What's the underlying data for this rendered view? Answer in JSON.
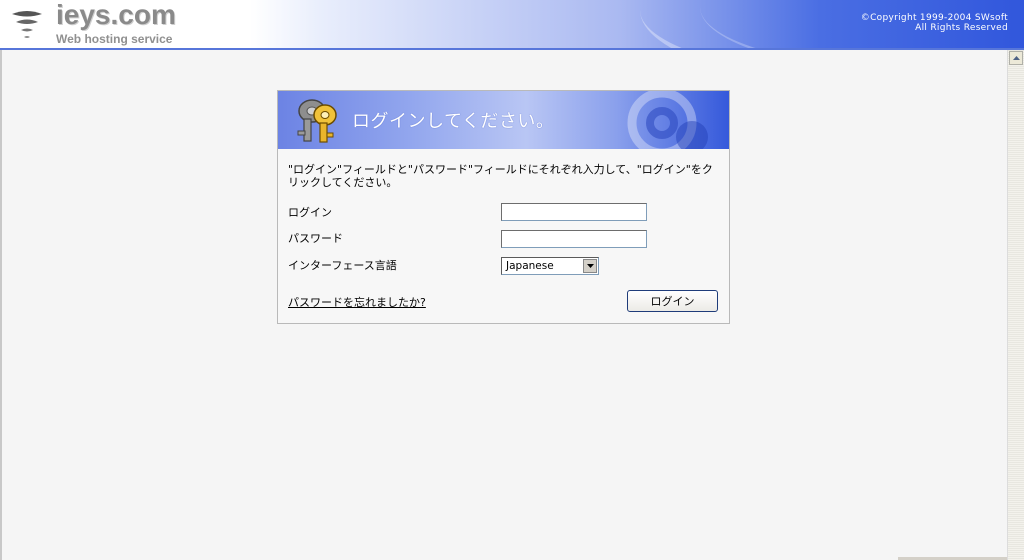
{
  "header": {
    "logo_text": "ieys.com",
    "logo_subtitle": "Web hosting service",
    "copyright_line1": "©Copyright 1999-2004 SWsoft",
    "copyright_line2": "All Rights Reserved",
    "logo_icon": "tornado-icon"
  },
  "login_panel": {
    "title": "ログインしてください。",
    "title_icon": "keys-icon",
    "instructions": "\"ログイン\"フィールドと\"パスワード\"フィールドにそれぞれ入力して、\"ログイン\"をクリックしてください。",
    "login_label": "ログイン",
    "login_value": "",
    "password_label": "パスワード",
    "password_value": "",
    "language_label": "インターフェース言語",
    "language_selected": "Japanese",
    "forgot_password_link": "パスワードを忘れましたか?",
    "login_button": "ログイン"
  },
  "colors": {
    "header_blue": "#3157dc",
    "panel_banner_blue": "#6c83e4",
    "page_background": "#f5f5f5",
    "button_border": "#1f3c7a"
  }
}
